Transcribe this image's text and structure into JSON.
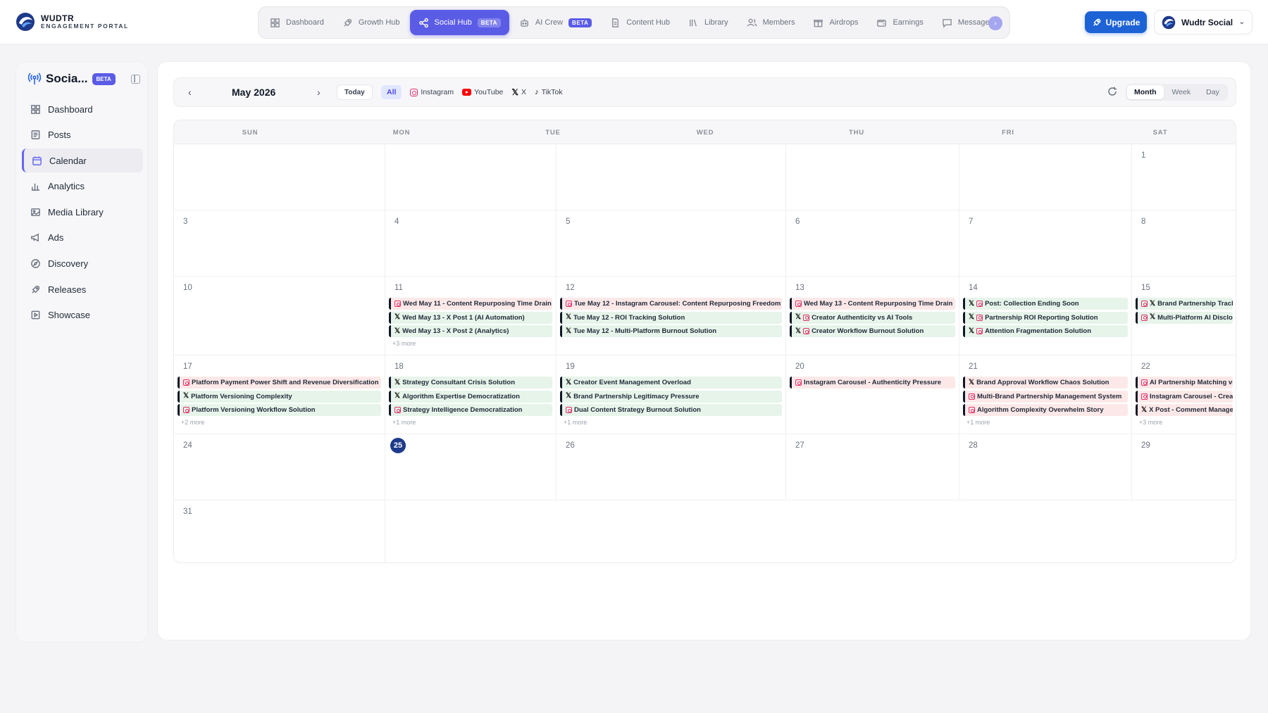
{
  "brand": {
    "title": "WUDTR",
    "subtitle": "ENGAGEMENT PORTAL"
  },
  "nav": {
    "items": [
      {
        "label": "Dashboard",
        "icon": "grid-icon",
        "active": false,
        "badge": ""
      },
      {
        "label": "Growth Hub",
        "icon": "rocket-icon",
        "active": false,
        "badge": ""
      },
      {
        "label": "Social Hub",
        "icon": "share-icon",
        "active": true,
        "badge": "BETA"
      },
      {
        "label": "AI Crew",
        "icon": "robot-icon",
        "active": false,
        "badge": "BETA"
      },
      {
        "label": "Content Hub",
        "icon": "document-icon",
        "active": false,
        "badge": ""
      },
      {
        "label": "Library",
        "icon": "library-icon",
        "active": false,
        "badge": ""
      },
      {
        "label": "Members",
        "icon": "users-icon",
        "active": false,
        "badge": ""
      },
      {
        "label": "Airdrops",
        "icon": "gift-icon",
        "active": false,
        "badge": ""
      },
      {
        "label": "Earnings",
        "icon": "wallet-icon",
        "active": false,
        "badge": ""
      },
      {
        "label": "Messages",
        "icon": "chat-icon",
        "active": false,
        "badge": ""
      }
    ]
  },
  "upgrade": {
    "label": "Upgrade"
  },
  "account": {
    "name": "Wudtr Social"
  },
  "sidebar": {
    "title": "Socia...",
    "badge": "BETA",
    "items": [
      {
        "label": "Dashboard",
        "icon": "grid-icon",
        "active": false
      },
      {
        "label": "Posts",
        "icon": "posts-icon",
        "active": false
      },
      {
        "label": "Calendar",
        "icon": "calendar-icon",
        "active": true
      },
      {
        "label": "Analytics",
        "icon": "bar-chart-icon",
        "active": false
      },
      {
        "label": "Media Library",
        "icon": "image-icon",
        "active": false
      },
      {
        "label": "Ads",
        "icon": "megaphone-icon",
        "active": false
      },
      {
        "label": "Discovery",
        "icon": "compass-icon",
        "active": false
      },
      {
        "label": "Releases",
        "icon": "rocket-icon",
        "active": false
      },
      {
        "label": "Showcase",
        "icon": "showcase-icon",
        "active": false
      }
    ]
  },
  "toolbar": {
    "month": "May 2026",
    "today": "Today",
    "filters": [
      {
        "label": "All",
        "icon": "",
        "active": true
      },
      {
        "label": "Instagram",
        "icon": "instagram-icon",
        "active": false
      },
      {
        "label": "YouTube",
        "icon": "youtube-icon",
        "active": false
      },
      {
        "label": "X",
        "icon": "x-icon",
        "active": false
      },
      {
        "label": "TikTok",
        "icon": "tiktok-icon",
        "active": false
      }
    ],
    "views": [
      {
        "label": "Month",
        "active": true
      },
      {
        "label": "Week",
        "active": false
      },
      {
        "label": "Day",
        "active": false
      }
    ]
  },
  "calendar": {
    "weekdays": [
      "SUN",
      "MON",
      "TUE",
      "WED",
      "THU",
      "FRI",
      "SAT"
    ],
    "weeks": [
      {
        "days": [
          "",
          "",
          "",
          "",
          "",
          "",
          "1"
        ]
      },
      {
        "days": [
          "3",
          "4",
          "5",
          "6",
          "7",
          "",
          "8"
        ]
      },
      {
        "days": [
          "10",
          "11",
          "12",
          "13",
          "14",
          "",
          "15"
        ]
      },
      {
        "days": [
          "17",
          "18",
          "19",
          "20",
          "21",
          "",
          "22"
        ]
      },
      {
        "days": [
          "24",
          "25",
          "26",
          "27",
          "28",
          "",
          "29"
        ]
      },
      {
        "days": [
          "31"
        ]
      }
    ],
    "today": "25",
    "events": {
      "11": {
        "items": [
          {
            "title": "Wed May 11 - Content Repurposing Time Drain",
            "icons": [
              "instagram"
            ],
            "tone": "red"
          },
          {
            "title": "Wed May 13 - X Post 1 (AI Automation)",
            "icons": [
              "x"
            ],
            "tone": "green"
          },
          {
            "title": "Wed May 13 - X Post 2 (Analytics)",
            "icons": [
              "x"
            ],
            "tone": "green"
          }
        ],
        "more": "+3 more"
      },
      "12": {
        "items": [
          {
            "title": "Tue May 12 - Instagram Carousel: Content Repurposing Freedom",
            "icons": [
              "instagram"
            ],
            "tone": "red"
          },
          {
            "title": "Tue May 12 - ROI Tracking Solution",
            "icons": [
              "x"
            ],
            "tone": "green"
          },
          {
            "title": "Tue May 12 - Multi-Platform Burnout Solution",
            "icons": [
              "x"
            ],
            "tone": "green"
          }
        ],
        "more": ""
      },
      "13": {
        "items": [
          {
            "title": "Wed May 13 - Content Repurposing Time Drain",
            "icons": [
              "instagram"
            ],
            "tone": "red"
          },
          {
            "title": "Creator Authenticity vs AI Tools",
            "icons": [
              "x",
              "instagram"
            ],
            "tone": "green"
          },
          {
            "title": "Creator Workflow Burnout Solution",
            "icons": [
              "x",
              "instagram"
            ],
            "tone": "green"
          }
        ],
        "more": ""
      },
      "14": {
        "items": [
          {
            "title": "Post: Collection Ending Soon",
            "icons": [
              "x",
              "instagram"
            ],
            "tone": "green"
          },
          {
            "title": "Partnership ROI Reporting Solution",
            "icons": [
              "x",
              "instagram"
            ],
            "tone": "green"
          },
          {
            "title": "Attention Fragmentation Solution",
            "icons": [
              "x",
              "instagram"
            ],
            "tone": "green"
          }
        ],
        "more": ""
      },
      "15": {
        "items": [
          {
            "title": "Brand Partnership Tracki",
            "icons": [
              "instagram",
              "x"
            ],
            "tone": "green"
          },
          {
            "title": "Multi-Platform AI Disclos",
            "icons": [
              "instagram",
              "x"
            ],
            "tone": "green"
          }
        ],
        "more": ""
      },
      "17": {
        "items": [
          {
            "title": "Platform Payment Power Shift and Revenue Diversification",
            "icons": [
              "instagram"
            ],
            "tone": "red"
          },
          {
            "title": "Platform Versioning Complexity",
            "icons": [
              "x"
            ],
            "tone": "green"
          },
          {
            "title": "Platform Versioning Workflow Solution",
            "icons": [
              "instagram"
            ],
            "tone": "green"
          }
        ],
        "more": "+2 more"
      },
      "18": {
        "items": [
          {
            "title": "Strategy Consultant Crisis Solution",
            "icons": [
              "x"
            ],
            "tone": "green"
          },
          {
            "title": "Algorithm Expertise Democratization",
            "icons": [
              "x"
            ],
            "tone": "green"
          },
          {
            "title": "Strategy Intelligence Democratization",
            "icons": [
              "instagram"
            ],
            "tone": "green"
          }
        ],
        "more": "+1 more"
      },
      "19": {
        "items": [
          {
            "title": "Creator Event Management Overload",
            "icons": [
              "x"
            ],
            "tone": "green"
          },
          {
            "title": "Brand Partnership Legitimacy Pressure",
            "icons": [
              "x"
            ],
            "tone": "green"
          },
          {
            "title": "Dual Content Strategy Burnout Solution",
            "icons": [
              "instagram"
            ],
            "tone": "green"
          }
        ],
        "more": "+1 more"
      },
      "20": {
        "items": [
          {
            "title": "Instagram Carousel - Authenticity Pressure",
            "icons": [
              "instagram"
            ],
            "tone": "red"
          }
        ],
        "more": ""
      },
      "21": {
        "items": [
          {
            "title": "Brand Approval Workflow Chaos Solution",
            "icons": [
              "x"
            ],
            "tone": "red"
          },
          {
            "title": "Multi-Brand Partnership Management System",
            "icons": [
              "instagram"
            ],
            "tone": "red"
          },
          {
            "title": "Algorithm Complexity Overwhelm Story",
            "icons": [
              "instagram"
            ],
            "tone": "red"
          }
        ],
        "more": "+1 more"
      },
      "22": {
        "items": [
          {
            "title": "AI Partnership Matching vs",
            "icons": [
              "instagram"
            ],
            "tone": "red"
          },
          {
            "title": "Instagram Carousel - Creat",
            "icons": [
              "instagram"
            ],
            "tone": "red"
          },
          {
            "title": "X Post - Comment Managem",
            "icons": [
              "x"
            ],
            "tone": "red"
          }
        ],
        "more": "+3 more"
      }
    }
  }
}
